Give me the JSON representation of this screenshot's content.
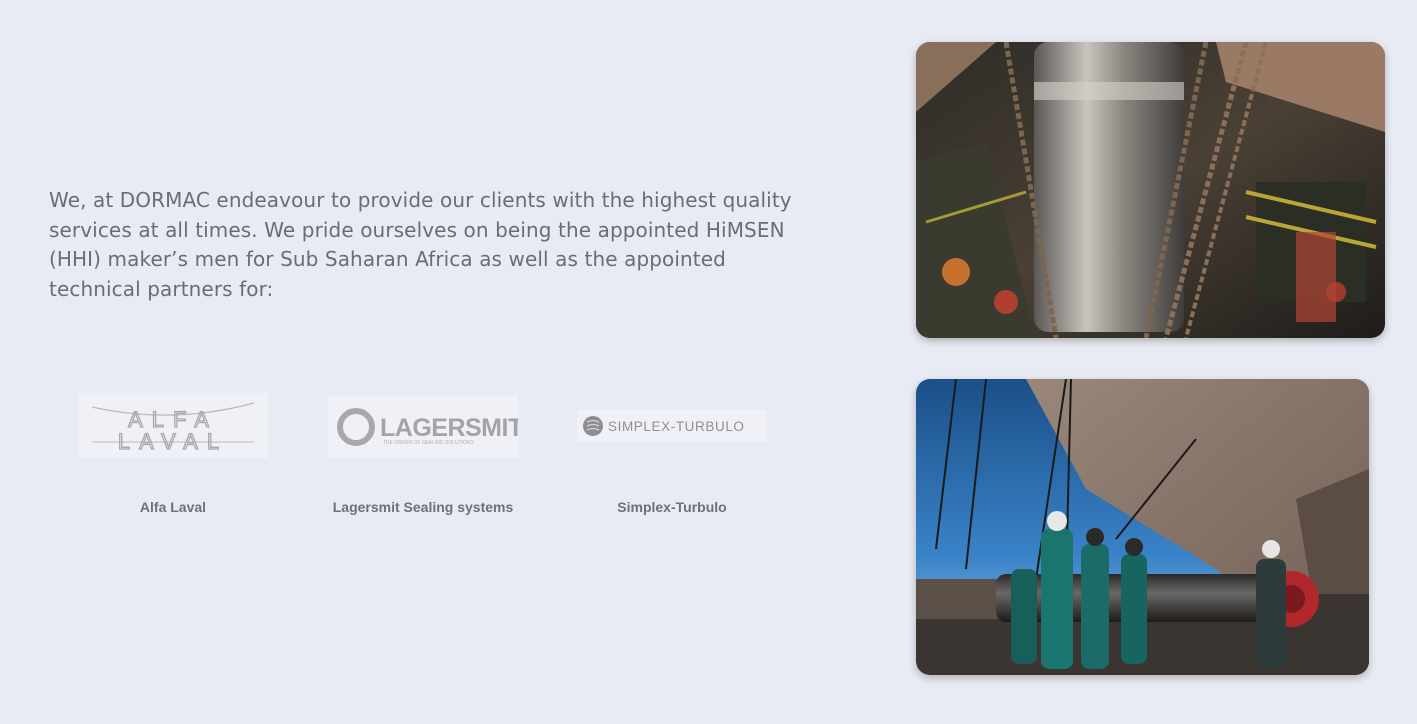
{
  "intro": {
    "text": "We, at DORMAC endeavour to provide our clients with the highest quality services at all times. We pride ourselves on being the appointed HiMSEN (HHI) maker’s men for Sub Saharan Africa as well as the appointed technical partners for:"
  },
  "partners": [
    {
      "name": "Alfa Laval",
      "logo_icon": "alfa-laval-logo",
      "logo_text_top": "ALFA",
      "logo_text_bottom": "LAVAL"
    },
    {
      "name": "Lagersmit Sealing systems",
      "logo_icon": "lagersmit-logo",
      "logo_text": "LAGERSMIT",
      "logo_tagline": "THE ORIGIN OF SEALING SOLUTIONS"
    },
    {
      "name": "Simplex-Turbulo",
      "logo_icon": "simplex-turbulo-logo",
      "logo_text": "SIMPLEX-TURBULO"
    }
  ],
  "photos": [
    {
      "icon": "ship-shaft-lifting-photo"
    },
    {
      "icon": "dry-dock-workers-photo"
    }
  ],
  "colors": {
    "background": "#e8ebf3",
    "text": "#6c6c72",
    "partner_label": "#707076"
  }
}
